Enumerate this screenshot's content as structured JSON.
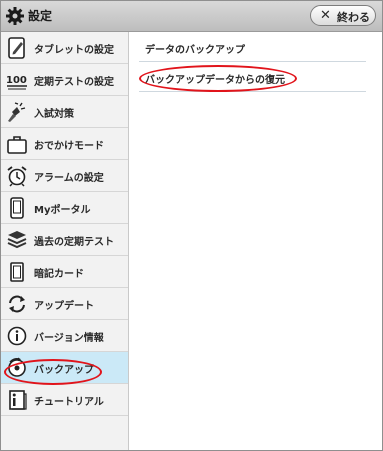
{
  "window": {
    "title": "設定",
    "close_label": "終わる"
  },
  "sidebar": {
    "items": [
      {
        "label": "タブレットの設定",
        "icon": "tablet-pencil-icon",
        "active": false
      },
      {
        "label": "定期テストの設定",
        "icon": "score-100-icon",
        "active": false
      },
      {
        "label": "入試対策",
        "icon": "flashlight-icon",
        "active": false
      },
      {
        "label": "おでかけモード",
        "icon": "suitcase-icon",
        "active": false
      },
      {
        "label": "アラームの設定",
        "icon": "alarm-clock-icon",
        "active": false
      },
      {
        "label": "Myポータル",
        "icon": "device-icon",
        "active": false
      },
      {
        "label": "過去の定期テスト",
        "icon": "stack-icon",
        "active": false
      },
      {
        "label": "暗記カード",
        "icon": "card-icon",
        "active": false
      },
      {
        "label": "アップデート",
        "icon": "refresh-icon",
        "active": false
      },
      {
        "label": "バージョン情報",
        "icon": "info-icon",
        "active": false
      },
      {
        "label": "バックアップ",
        "icon": "backup-disc-icon",
        "active": true
      },
      {
        "label": "チュートリアル",
        "icon": "tutorial-book-icon",
        "active": false
      }
    ]
  },
  "panel": {
    "section_label": "データのバックアップ",
    "restore_label": "バックアップデータからの復元"
  },
  "colors": {
    "active_item": "#cbe9f7",
    "annotation": "#e1141b"
  }
}
